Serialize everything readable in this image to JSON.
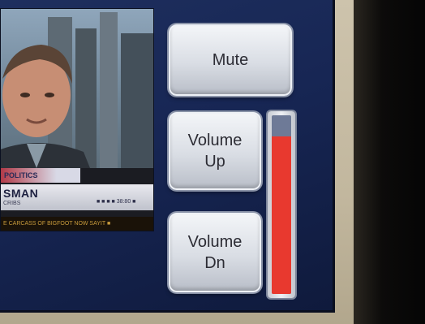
{
  "video_feed": {
    "tag": "POLITICS",
    "name": "SMAN",
    "subtitle": "CRIBS",
    "clock": "■ ■ ■ ■  38:80 ■",
    "ticker": "E CARCASS OF BIGFOOT NOW SAYIT ■"
  },
  "controls": {
    "mute_label": "Mute",
    "volume_up_label": "Volume\nUp",
    "volume_down_label": "Volume\nDn"
  },
  "volume_meter": {
    "level_fraction": 0.88,
    "fill_color": "#e8392f",
    "track_color": "#6e7a97"
  }
}
